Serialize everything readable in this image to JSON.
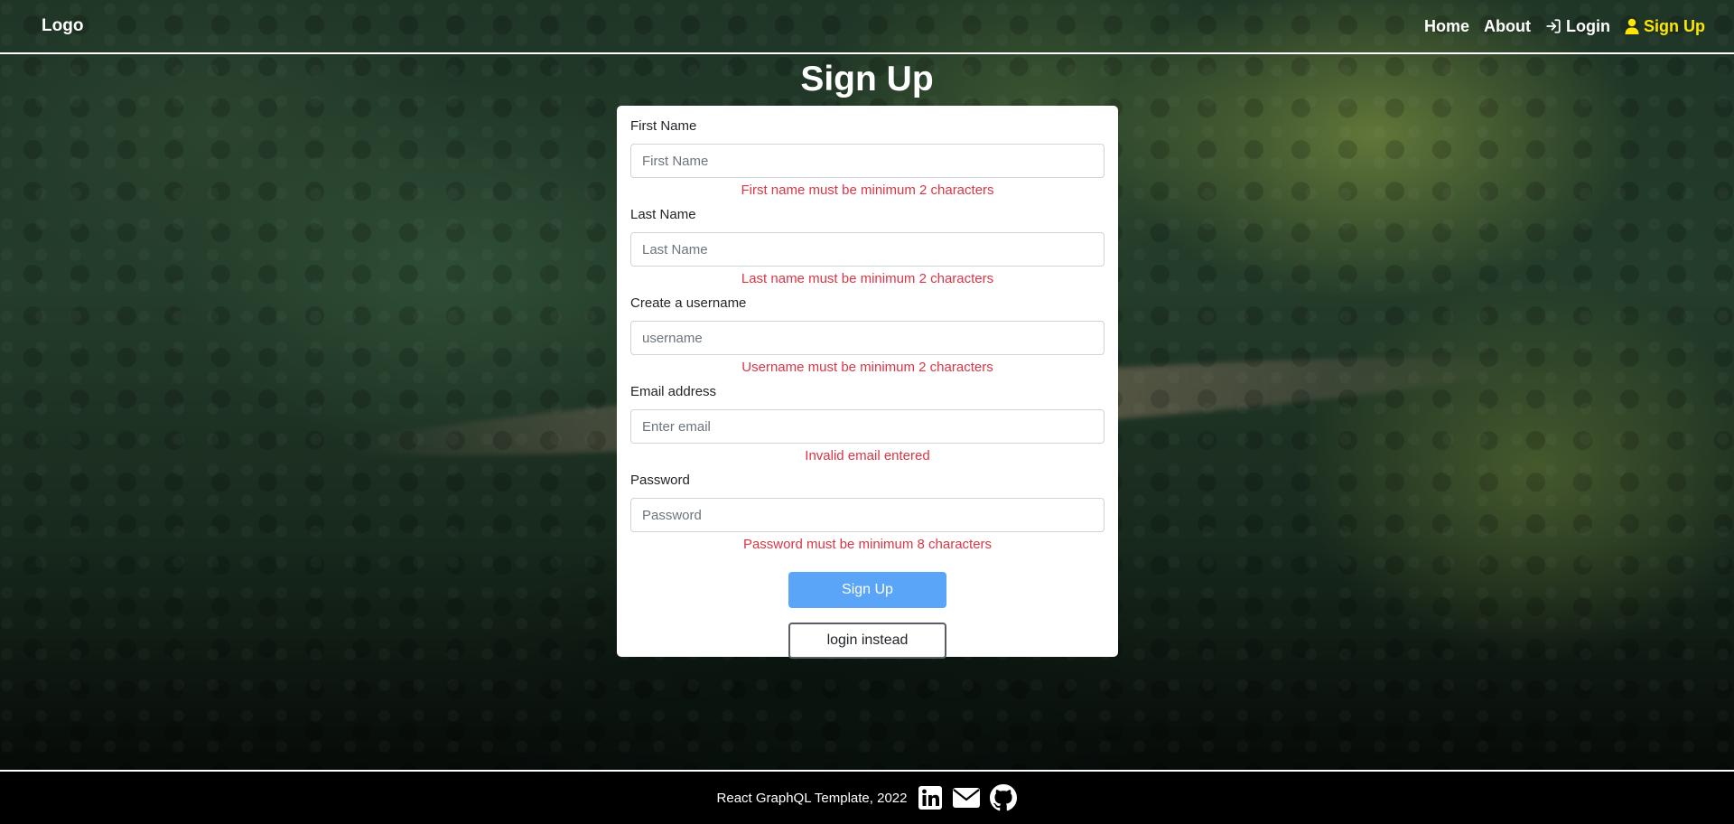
{
  "navbar": {
    "logo": "Logo",
    "links": [
      {
        "label": "Home",
        "icon": null
      },
      {
        "label": "About",
        "icon": null
      },
      {
        "label": "Login",
        "icon": "login-icon"
      },
      {
        "label": "Sign Up",
        "icon": "user-icon",
        "active": true
      }
    ]
  },
  "page": {
    "title": "Sign Up"
  },
  "form": {
    "fields": [
      {
        "label": "First Name",
        "placeholder": "First Name",
        "value": "",
        "error": "First name must be minimum 2 characters"
      },
      {
        "label": "Last Name",
        "placeholder": "Last Name",
        "value": "",
        "error": "Last name must be minimum 2 characters"
      },
      {
        "label": "Create a username",
        "placeholder": "username",
        "value": "",
        "error": "Username must be minimum 2 characters"
      },
      {
        "label": "Email address",
        "placeholder": "Enter email",
        "value": "",
        "error": "Invalid email entered"
      },
      {
        "label": "Password",
        "placeholder": "Password",
        "value": "",
        "error": "Password must be minimum 8 characters"
      }
    ],
    "submit_label": "Sign Up",
    "alt_label": "login instead"
  },
  "footer": {
    "text": "React GraphQL Template, 2022",
    "icons": [
      "linkedin-icon",
      "envelope-icon",
      "github-icon"
    ]
  },
  "colors": {
    "active_nav": "#ffe600",
    "error": "#dc3545",
    "primary_button": "#5aa5f8"
  }
}
